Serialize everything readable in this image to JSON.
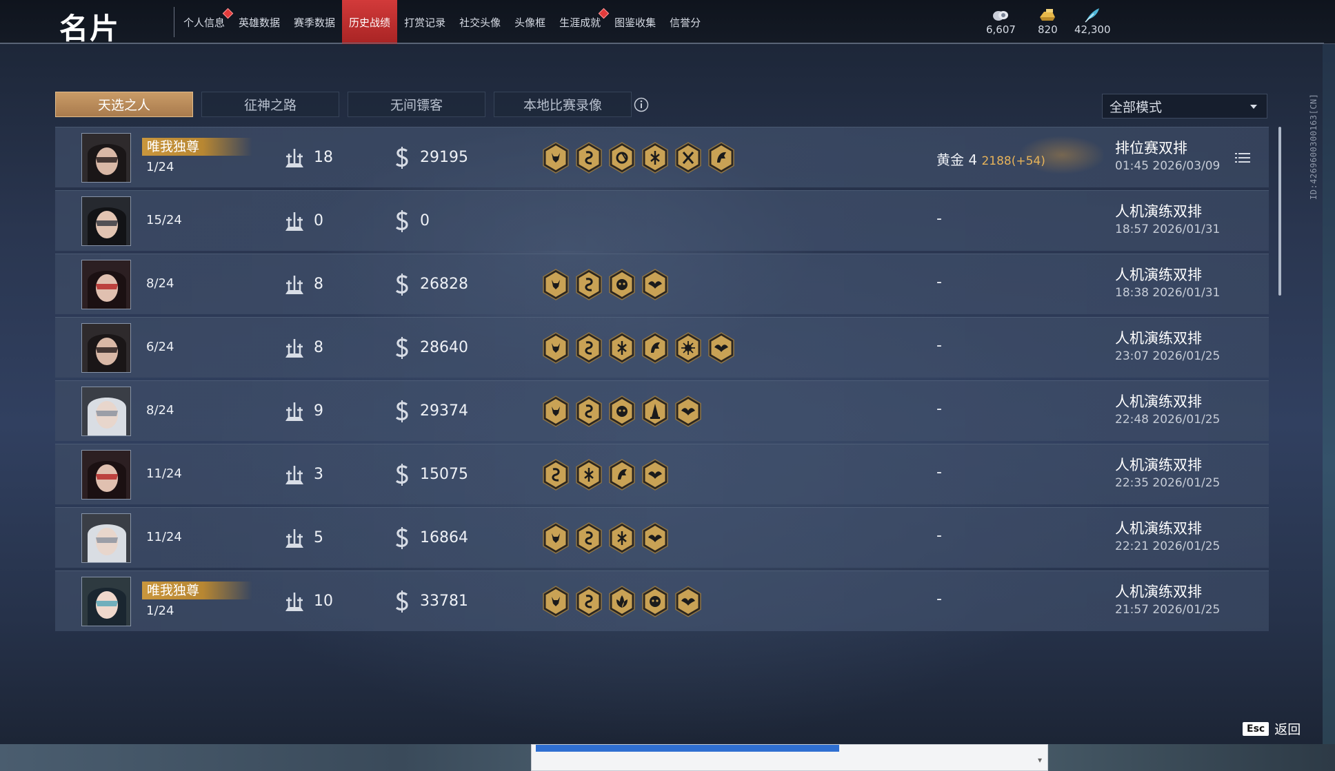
{
  "header": {
    "title": "名片",
    "nav": [
      {
        "label": "个人信息",
        "dot": true,
        "active": false
      },
      {
        "label": "英雄数据",
        "dot": false,
        "active": false
      },
      {
        "label": "赛季数据",
        "dot": false,
        "active": false
      },
      {
        "label": "历史战绩",
        "dot": false,
        "active": true
      },
      {
        "label": "打赏记录",
        "dot": false,
        "active": false
      },
      {
        "label": "社交头像",
        "dot": false,
        "active": false
      },
      {
        "label": "头像框",
        "dot": false,
        "active": false
      },
      {
        "label": "生涯成就",
        "dot": true,
        "active": false
      },
      {
        "label": "图鉴收集",
        "dot": false,
        "active": false
      },
      {
        "label": "信誉分",
        "dot": false,
        "active": false
      }
    ],
    "currencies": [
      {
        "value": "6,607",
        "icon": "coin-cloud-icon"
      },
      {
        "value": "820",
        "icon": "gold-ingot-icon"
      },
      {
        "value": "42,300",
        "icon": "feather-icon"
      }
    ]
  },
  "side_id": "ID:4269600300163[CN]",
  "tabs": [
    "天选之人",
    "征神之路",
    "无间镖客",
    "本地比赛录像"
  ],
  "mode_filter": "全部模式",
  "rows": [
    {
      "badge": "唯我独尊",
      "rank": "1/24",
      "kills": "18",
      "money": "29195",
      "hexes": [
        "demon",
        "serpent",
        "swirl",
        "blades",
        "cross-swords",
        "horse"
      ],
      "rank_info": "黄金 4",
      "rank_points": "2188(+54)",
      "mode": "排位赛双排",
      "time": "01:45  2026/03/09",
      "avatar": "a1"
    },
    {
      "badge": "",
      "rank": "15/24",
      "kills": "0",
      "money": "0",
      "hexes": [],
      "rank_info": "-",
      "rank_points": "",
      "mode": "人机演练双排",
      "time": "18:57  2026/01/31",
      "avatar": "a2"
    },
    {
      "badge": "",
      "rank": "8/24",
      "kills": "8",
      "money": "26828",
      "hexes": [
        "demon",
        "serpent",
        "face",
        "wings"
      ],
      "rank_info": "-",
      "rank_points": "",
      "mode": "人机演练双排",
      "time": "18:38  2026/01/31",
      "avatar": "a3"
    },
    {
      "badge": "",
      "rank": "6/24",
      "kills": "8",
      "money": "28640",
      "hexes": [
        "demon",
        "serpent",
        "blades",
        "horse",
        "sun",
        "wings"
      ],
      "rank_info": "-",
      "rank_points": "",
      "mode": "人机演练双排",
      "time": "23:07  2026/01/25",
      "avatar": "a1"
    },
    {
      "badge": "",
      "rank": "8/24",
      "kills": "9",
      "money": "29374",
      "hexes": [
        "demon",
        "serpent",
        "face",
        "tower",
        "wings"
      ],
      "rank_info": "-",
      "rank_points": "",
      "mode": "人机演练双排",
      "time": "22:48  2026/01/25",
      "avatar": "a4"
    },
    {
      "badge": "",
      "rank": "11/24",
      "kills": "3",
      "money": "15075",
      "hexes": [
        "serpent",
        "blades",
        "horse",
        "wings"
      ],
      "rank_info": "-",
      "rank_points": "",
      "mode": "人机演练双排",
      "time": "22:35  2026/01/25",
      "avatar": "a3"
    },
    {
      "badge": "",
      "rank": "11/24",
      "kills": "5",
      "money": "16864",
      "hexes": [
        "demon",
        "serpent",
        "blades",
        "wings"
      ],
      "rank_info": "-",
      "rank_points": "",
      "mode": "人机演练双排",
      "time": "22:21  2026/01/25",
      "avatar": "a4"
    },
    {
      "badge": "唯我独尊",
      "rank": "1/24",
      "kills": "10",
      "money": "33781",
      "hexes": [
        "demon",
        "serpent",
        "lotus",
        "face",
        "wings"
      ],
      "rank_info": "-",
      "rank_points": "",
      "mode": "人机演练双排",
      "time": "21:57  2026/01/25",
      "avatar": "a5"
    }
  ],
  "footer": {
    "esc_key": "Esc",
    "back_label": "返回"
  },
  "colors": {
    "accent_red": "#d23a3a",
    "tab_gold": "#c99b67",
    "badge_gold": "#c9963d",
    "points_gold": "#e7b35a"
  }
}
